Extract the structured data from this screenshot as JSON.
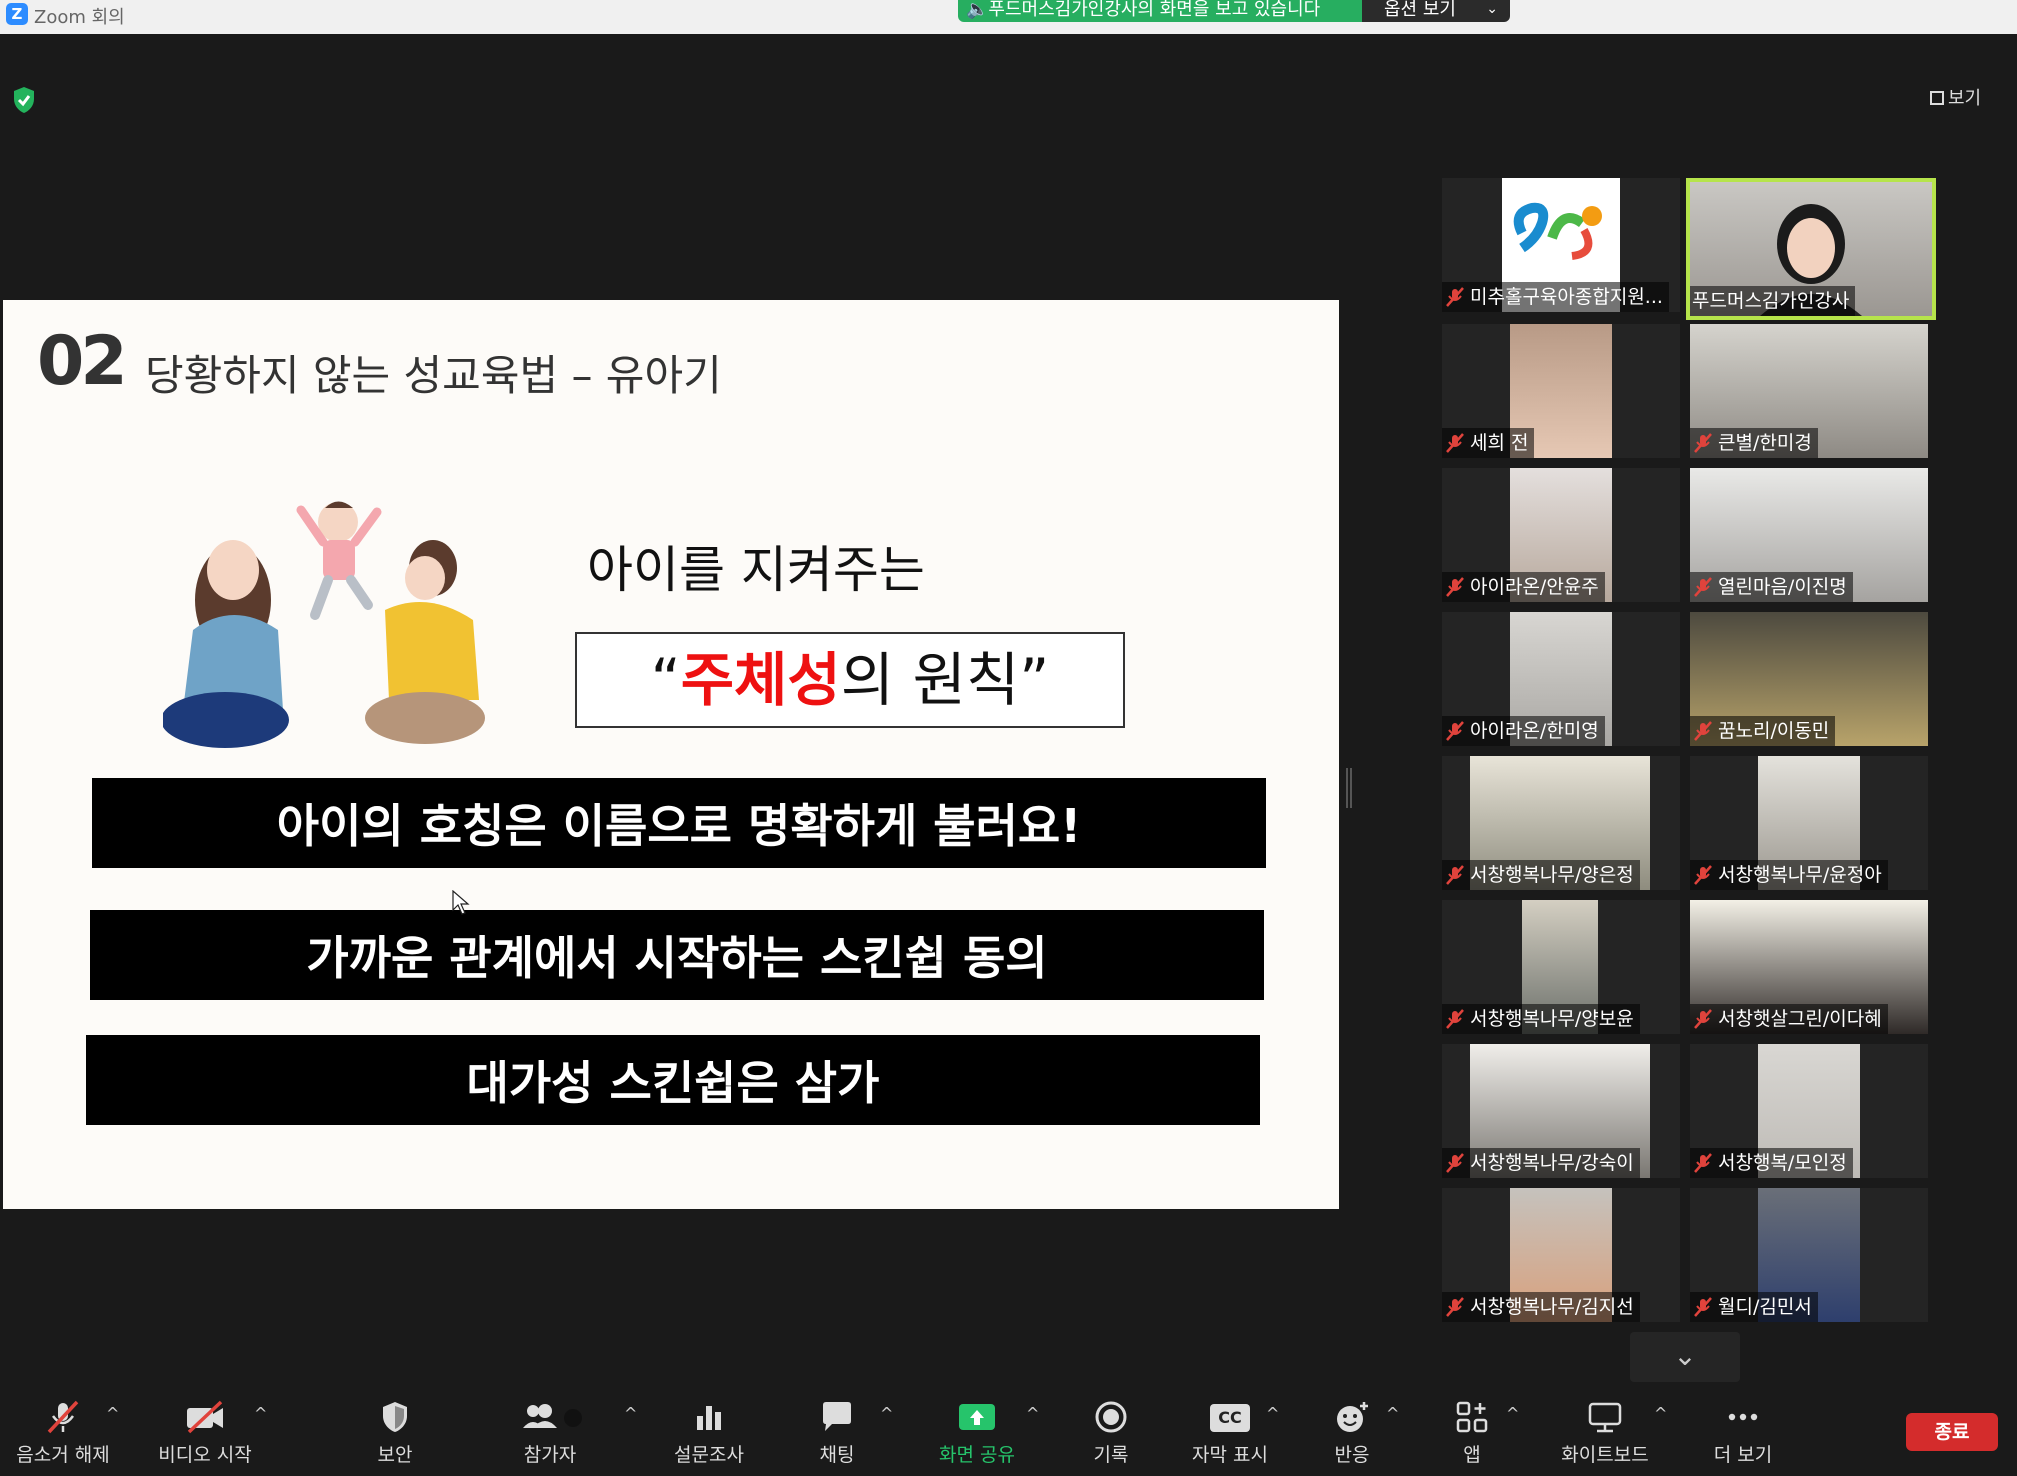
{
  "window": {
    "app_title": "Zoom 회의",
    "share_banner": "푸드머스김가인강사의 화면을 보고 있습니다",
    "view_options": "옵션 보기",
    "view_button": "보기"
  },
  "slide": {
    "number": "02",
    "title": "당황하지 않는 성교육법 – 유아기",
    "subhead": "아이를 지켜주는",
    "principle_open": "“",
    "principle_highlight": "주체성",
    "principle_rest": "의 원칙”",
    "bars": [
      "아이의 호칭은 이름으로 명확하게 불러요!",
      "가까운 관계에서 시작하는 스킨쉽 동의",
      "대가성 스킨쉽은 삼가"
    ]
  },
  "participants": [
    {
      "name": "미추홀구육아종합지원...",
      "active": false
    },
    {
      "name": "푸드머스김가인강사",
      "active": true
    },
    {
      "name": "세희 전",
      "active": false
    },
    {
      "name": "큰별/한미경",
      "active": false
    },
    {
      "name": "아이라온/안윤주",
      "active": false
    },
    {
      "name": "열린마음/이진명",
      "active": false
    },
    {
      "name": "아이라온/한미영",
      "active": false
    },
    {
      "name": "꿈노리/이동민",
      "active": false
    },
    {
      "name": "서창행복나무/양은정",
      "active": false
    },
    {
      "name": "서창행복나무/윤정아",
      "active": false
    },
    {
      "name": "서창행복나무/양보윤",
      "active": false
    },
    {
      "name": "서창햇살그린/이다혜",
      "active": false
    },
    {
      "name": "서창행복나무/강숙이",
      "active": false
    },
    {
      "name": "서창행복/모인정",
      "active": false
    },
    {
      "name": "서창행복나무/김지선",
      "active": false
    },
    {
      "name": "월디/김민서",
      "active": false
    }
  ],
  "toolbar": {
    "unmute": "음소거 해제",
    "start_video": "비디오 시작",
    "security": "보안",
    "participants": "참가자",
    "polls": "설문조사",
    "chat": "채팅",
    "share_screen": "화면 공유",
    "record": "기록",
    "captions": "자막 표시",
    "captions_icon_text": "CC",
    "reactions": "반응",
    "apps": "앱",
    "whiteboard": "화이트보드",
    "more": "더 보기",
    "end": "종료"
  },
  "icons": {
    "security_shield": "shield-check-icon",
    "gallery_down": "chevron-down-icon"
  },
  "colors": {
    "share_banner": "#27ae60",
    "active_speaker_border": "#b6e44b",
    "end_button": "#d42c2c",
    "muted_icon": "#e0433c",
    "highlight_text": "#ee1111"
  }
}
